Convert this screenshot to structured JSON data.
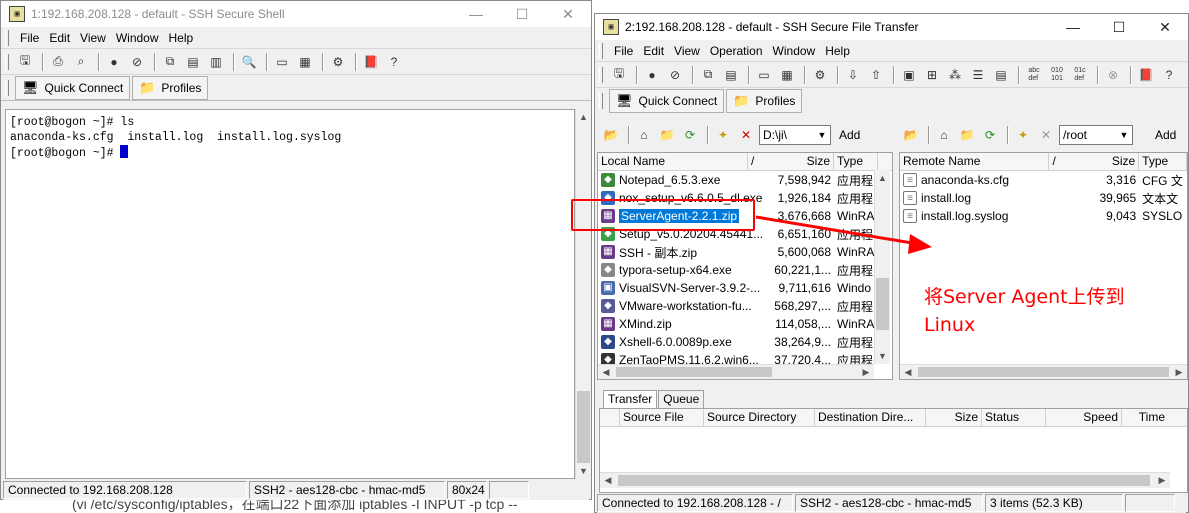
{
  "shell": {
    "title": "1:192.168.208.128 - default - SSH Secure Shell",
    "menu": [
      "File",
      "Edit",
      "View",
      "Window",
      "Help"
    ],
    "quick_connect": "Quick Connect",
    "profiles": "Profiles",
    "terminal_lines": [
      "[root@bogon ~]# ls",
      "anaconda-ks.cfg  install.log  install.log.syslog",
      "[root@bogon ~]# "
    ],
    "status": [
      "Connected to 192.168.208.128",
      "SSH2 - aes128-cbc - hmac-md5",
      "80x24"
    ]
  },
  "ftp": {
    "title": "2:192.168.208.128 - default - SSH Secure File Transfer",
    "menu": [
      "File",
      "Edit",
      "View",
      "Operation",
      "Window",
      "Help"
    ],
    "quick_connect": "Quick Connect",
    "profiles": "Profiles",
    "local_path": "D:\\ji\\",
    "remote_path": "/root",
    "add_label": "Add",
    "local_headers": [
      "Local Name",
      "/",
      "Size",
      "Type"
    ],
    "remote_headers": [
      "Remote Name",
      "/",
      "Size",
      "Type"
    ],
    "local_files": [
      {
        "name": "Notepad_6.5.3.exe",
        "size": "7,598,942",
        "type": "应用程",
        "icon": "app-icon",
        "color": "#3c8a3c"
      },
      {
        "name": "nox_setup_v6.6.0.5_dl.exe",
        "size": "1,926,184",
        "type": "应用程",
        "icon": "app-icon",
        "color": "#2d6bbf"
      },
      {
        "name": "ServerAgent-2.2.1.zip",
        "size": "3,676,668",
        "type": "WinRA",
        "icon": "zip-icon",
        "color": "#6a3a8a"
      },
      {
        "name": "Setup_v5.0.20204.45441...",
        "size": "6,651,160",
        "type": "应用程",
        "icon": "app-icon",
        "color": "#3aa04a"
      },
      {
        "name": "SSH - 副本.zip",
        "size": "5,600,068",
        "type": "WinRA",
        "icon": "zip-icon",
        "color": "#6a3a8a"
      },
      {
        "name": "typora-setup-x64.exe",
        "size": "60,221,1...",
        "type": "应用程",
        "icon": "app-icon",
        "color": "#888888"
      },
      {
        "name": "VisualSVN-Server-3.9.2-...",
        "size": "9,711,616",
        "type": "Windo",
        "icon": "msi-icon",
        "color": "#4a6ab0"
      },
      {
        "name": "VMware-workstation-fu...",
        "size": "568,297,...",
        "type": "应用程",
        "icon": "app-icon",
        "color": "#5a5a9a"
      },
      {
        "name": "XMind.zip",
        "size": "114,058,...",
        "type": "WinRA",
        "icon": "zip-icon",
        "color": "#6a3a8a"
      },
      {
        "name": "Xshell-6.0.0089p.exe",
        "size": "38,264,9...",
        "type": "应用程",
        "icon": "app-icon",
        "color": "#2a4a8a"
      },
      {
        "name": "ZenTaoPMS.11.6.2.win6...",
        "size": "37,720,4...",
        "type": "应用程",
        "icon": "app-icon",
        "color": "#333333"
      }
    ],
    "selected_index": 2,
    "remote_files": [
      {
        "name": "anaconda-ks.cfg",
        "size": "3,316",
        "type": "CFG 文"
      },
      {
        "name": "install.log",
        "size": "39,965",
        "type": "文本文"
      },
      {
        "name": "install.log.syslog",
        "size": "9,043",
        "type": "SYSLO"
      }
    ],
    "transfer_tabs": [
      "Transfer",
      "Queue"
    ],
    "transfer_headers": [
      "Source File",
      "Source Directory",
      "Destination Dire...",
      "Size",
      "Status",
      "Speed",
      "Time"
    ],
    "status": [
      "Connected to 192.168.208.128 - /",
      "SSH2 - aes128-cbc - hmac-md5",
      "3 items (52.3 KB)"
    ]
  },
  "annotation": {
    "line1": "将Server Agent上传到",
    "line2": "Linux",
    "color": "#ff0000"
  },
  "background_text": "(vi /etc/sysconfig/iptables，在端口22下面添加 iptables -I INPUT -p tcp --"
}
